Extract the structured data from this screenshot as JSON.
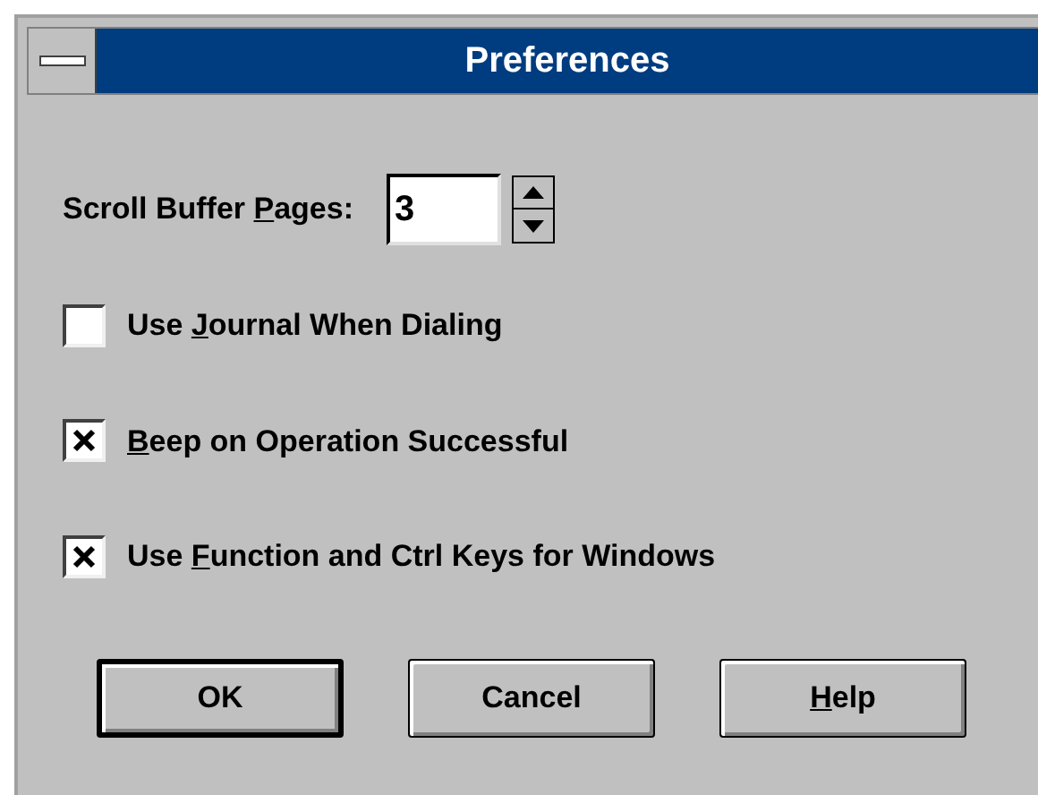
{
  "window": {
    "title": "Preferences"
  },
  "scroll_buffer": {
    "label": {
      "pre": "Scroll Buffer ",
      "key": "P",
      "post": "ages:"
    },
    "value": "3"
  },
  "options": [
    {
      "label": {
        "pre": "Use ",
        "key": "J",
        "post": "ournal When Dialing"
      },
      "checked": false
    },
    {
      "label": {
        "key": "B",
        "post": "eep on Operation Successful"
      },
      "checked": true
    },
    {
      "label": {
        "pre": "Use ",
        "key": "F",
        "post": "unction and Ctrl Keys for Windows"
      },
      "checked": true
    }
  ],
  "buttons": [
    {
      "label": {
        "pre": "OK"
      },
      "default": true
    },
    {
      "label": {
        "pre": "Cancel"
      },
      "default": false
    },
    {
      "label": {
        "key": "H",
        "post": "elp"
      },
      "default": false
    }
  ]
}
